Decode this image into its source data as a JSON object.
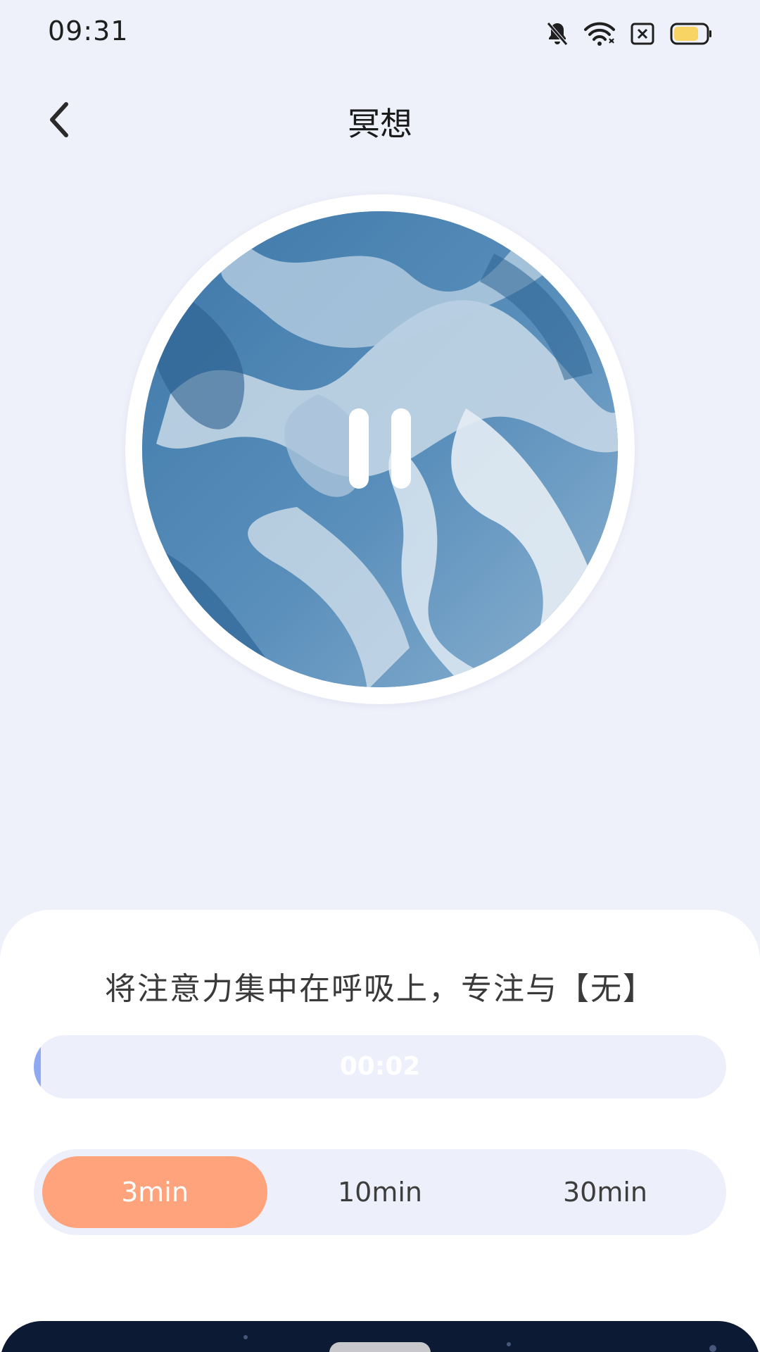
{
  "status_bar": {
    "time": "09:31",
    "icons": [
      "bell-off-icon",
      "wifi-icon",
      "sim-disabled-icon",
      "battery-icon"
    ],
    "battery_color": "#f7d463"
  },
  "header": {
    "title": "冥想",
    "back_icon": "chevron-left-icon"
  },
  "player": {
    "state_icon": "pause-icon",
    "artwork": "blue-marble-swirl"
  },
  "guide": {
    "text": "将注意力集中在呼吸上，专注与【无】"
  },
  "progress": {
    "elapsed": "00:02",
    "fraction": 0.01,
    "fill_color": "#8ea8f2"
  },
  "durations": {
    "options": [
      {
        "label": "3min",
        "selected": true
      },
      {
        "label": "10min",
        "selected": false
      },
      {
        "label": "30min",
        "selected": false
      }
    ],
    "active_color": "#fea37c"
  }
}
